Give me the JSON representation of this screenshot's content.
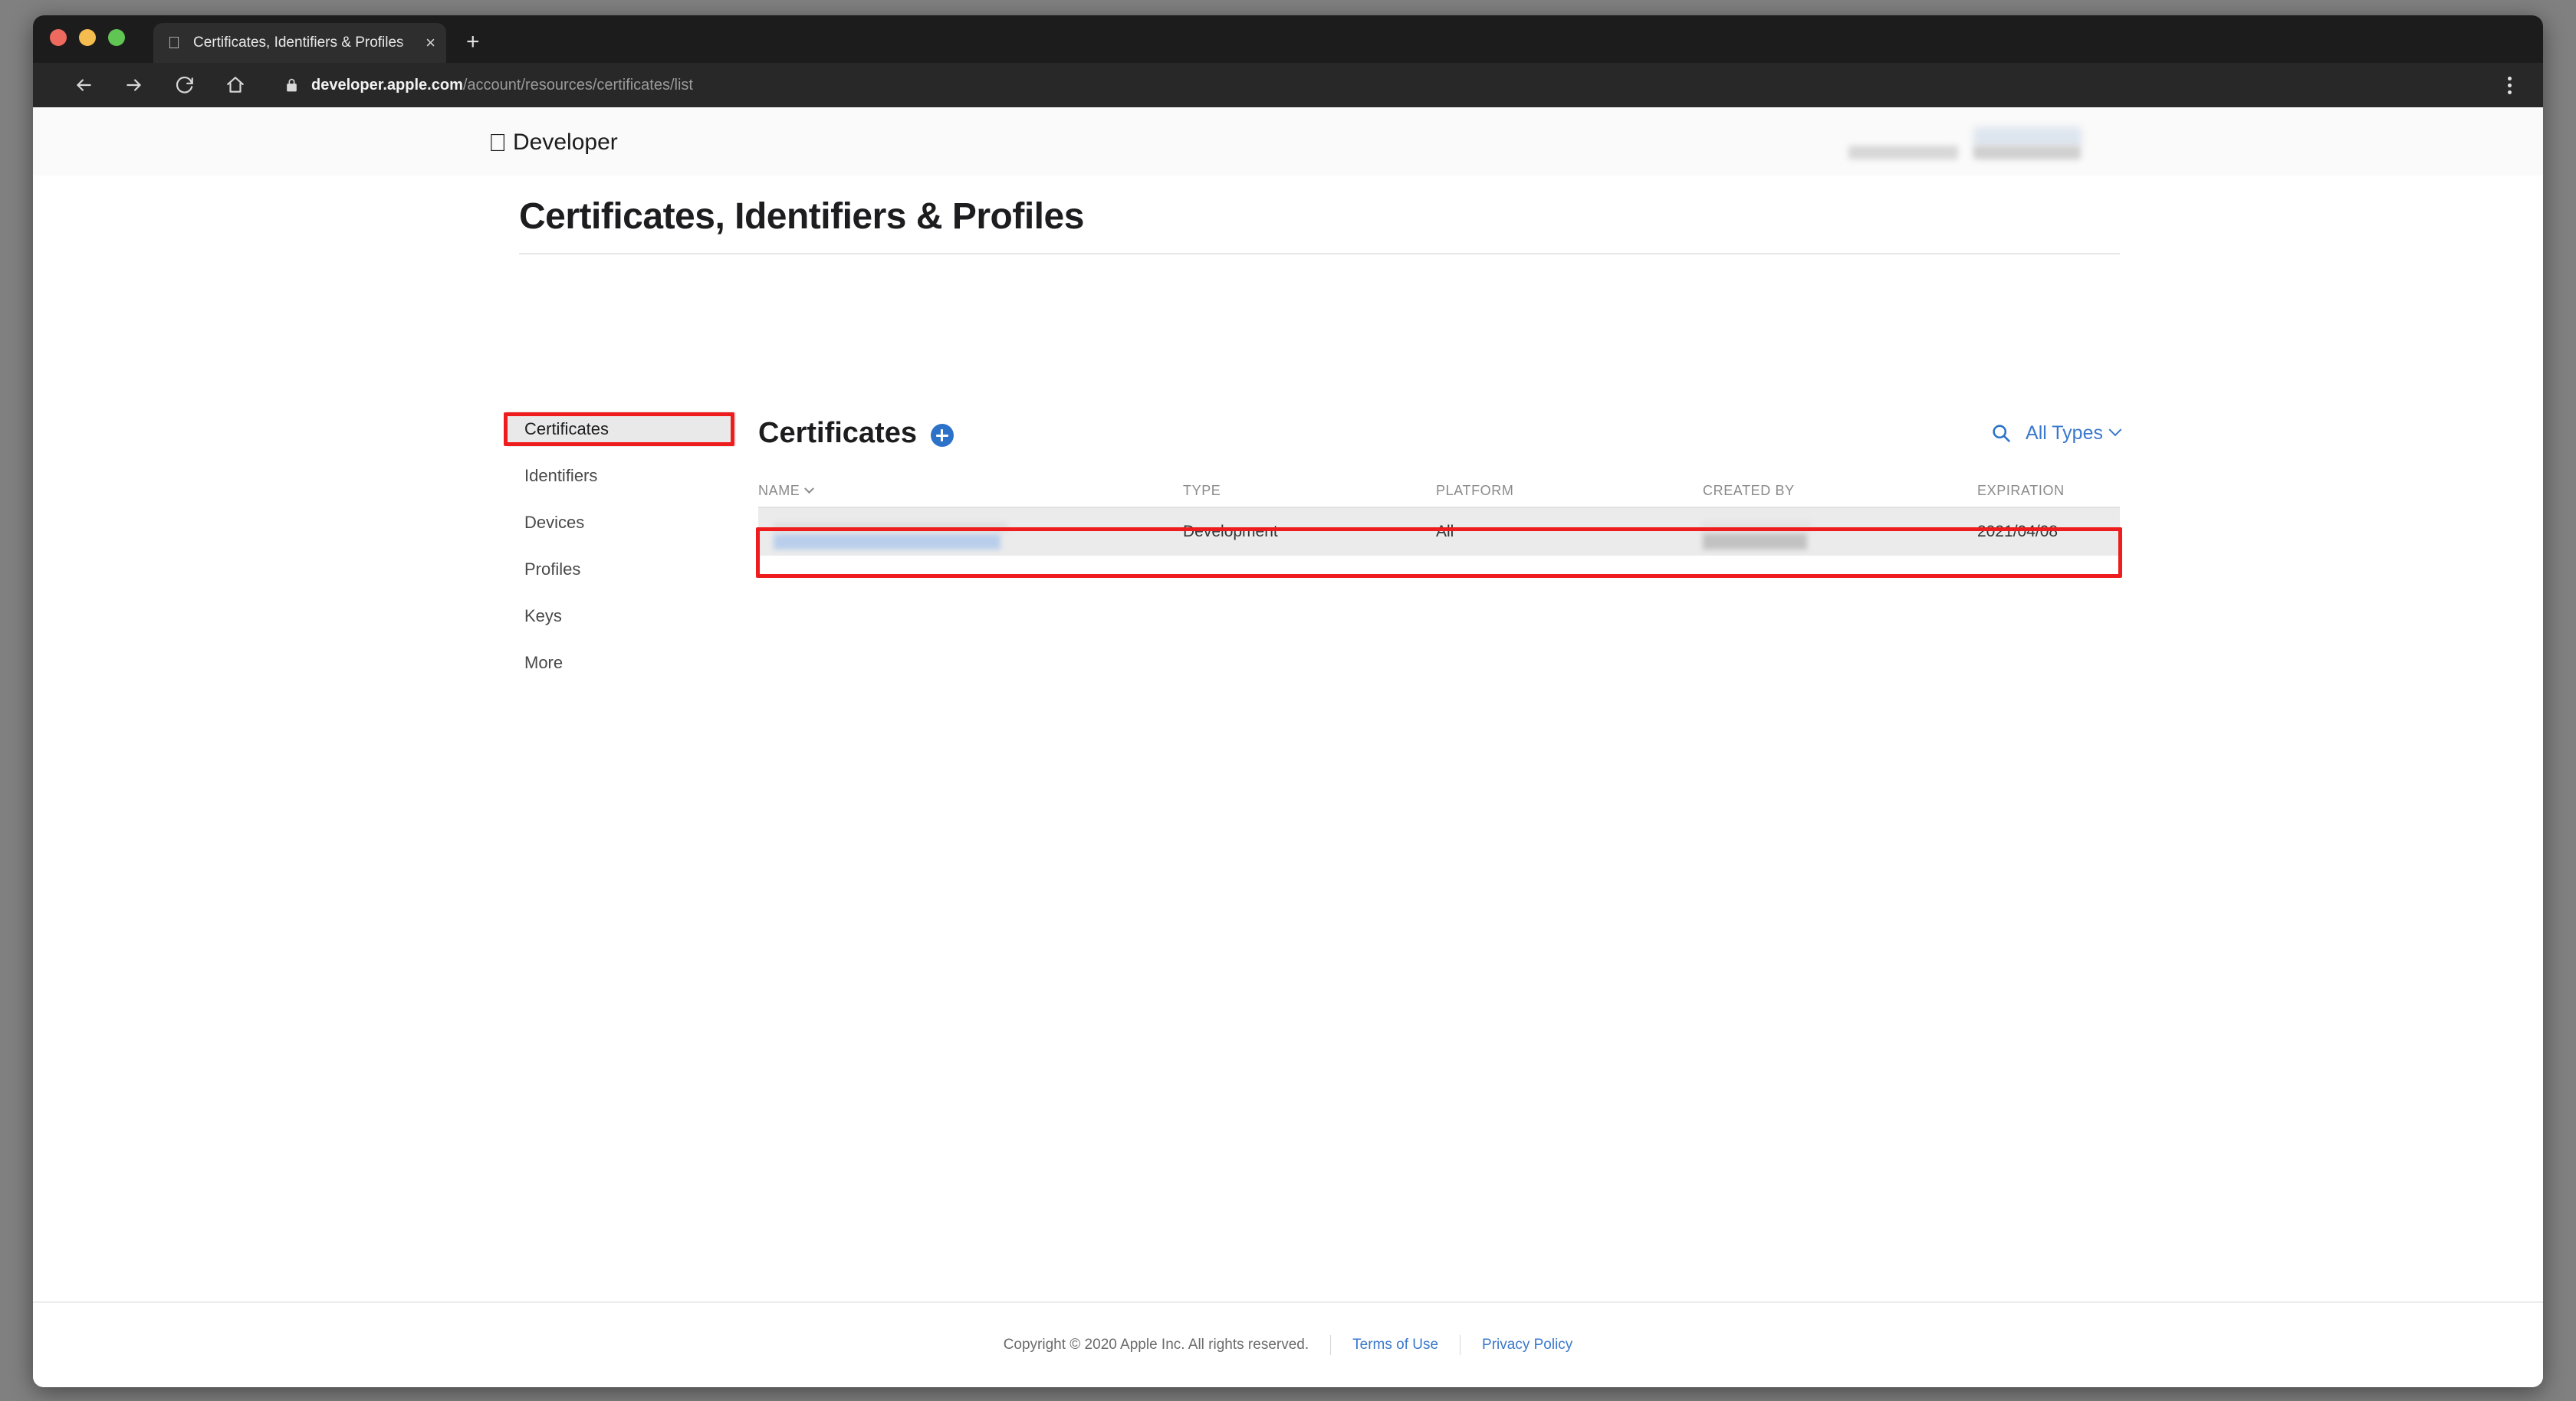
{
  "browser": {
    "tab": {
      "title": "Certificates, Identifiers & Profiles",
      "favicon": "apple-icon",
      "close_label": "×"
    },
    "new_tab_label": "+",
    "toolbar": {
      "back_label": "back-icon",
      "forward_label": "forward-icon",
      "reload_label": "reload-icon",
      "home_label": "home-icon",
      "lock_label": "lock-icon",
      "url_host": "developer.apple.com",
      "url_path": "/account/resources/certificates/list",
      "menu_label": "kebab-menu-icon"
    }
  },
  "gnav": {
    "apple_glyph": "",
    "brand": "Developer",
    "account_redacted": true
  },
  "page": {
    "title": "Certificates, Identifiers & Profiles"
  },
  "sidebar": {
    "items": [
      {
        "label": "Certificates",
        "active": true
      },
      {
        "label": "Identifiers",
        "active": false
      },
      {
        "label": "Devices",
        "active": false
      },
      {
        "label": "Profiles",
        "active": false
      },
      {
        "label": "Keys",
        "active": false
      },
      {
        "label": "More",
        "active": false
      }
    ]
  },
  "content": {
    "title": "Certificates",
    "add_button_label": "+",
    "search_icon": "search-icon",
    "type_filter": {
      "label": "All Types",
      "chevron": "chevron-down-icon"
    },
    "table": {
      "columns": [
        {
          "key": "name",
          "label": "NAME",
          "sortable": true
        },
        {
          "key": "type",
          "label": "TYPE",
          "sortable": false
        },
        {
          "key": "platform",
          "label": "PLATFORM",
          "sortable": false
        },
        {
          "key": "created_by",
          "label": "CREATED BY",
          "sortable": false
        },
        {
          "key": "expiration",
          "label": "EXPIRATION",
          "sortable": false
        }
      ],
      "rows": [
        {
          "name": "",
          "name_redacted": true,
          "type": "Development",
          "platform": "All",
          "created_by": "",
          "created_by_redacted": true,
          "expiration": "2021/04/08",
          "highlighted": true
        }
      ]
    }
  },
  "footer": {
    "copyright": "Copyright © 2020 Apple Inc. All rights reserved.",
    "terms_link": "Terms of Use",
    "privacy_link": "Privacy Policy"
  },
  "annotations": {
    "highlight_color": "#ee1c1c",
    "accent_blue": "#3a78cc",
    "add_button_blue": "#2d72c9"
  }
}
